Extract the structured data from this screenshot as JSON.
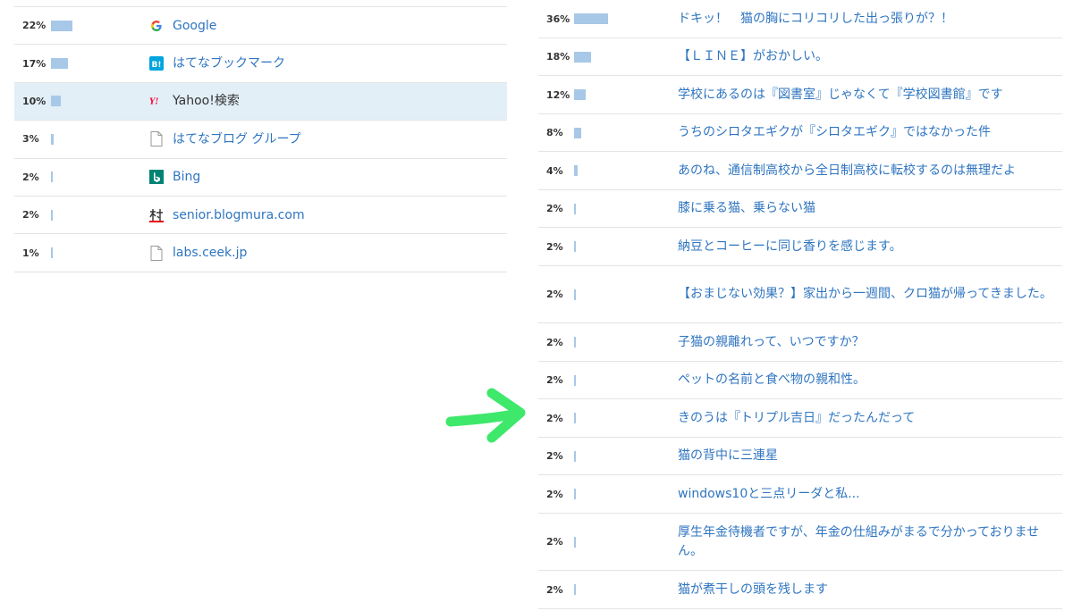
{
  "colors": {
    "bar": "#a7c8e7",
    "link": "#2f75c0",
    "text": "#333333",
    "selected_row": "#e2eff7",
    "divider": "#e4e4e4",
    "arrow": "#3ee86a"
  },
  "referrers": [
    {
      "percent": "22%",
      "value": 22,
      "label": "Google",
      "icon": "google-icon"
    },
    {
      "percent": "17%",
      "value": 17,
      "label": "はてなブックマーク",
      "icon": "hatena-bookmark-icon"
    },
    {
      "percent": "10%",
      "value": 10,
      "label": "Yahoo!検索",
      "icon": "yahoo-icon"
    },
    {
      "percent": "3%",
      "value": 3,
      "label": "はてなブログ グループ",
      "icon": "document-icon"
    },
    {
      "percent": "2%",
      "value": 2,
      "label": "Bing",
      "icon": "bing-icon"
    },
    {
      "percent": "2%",
      "value": 2,
      "label": "senior.blogmura.com",
      "icon": "blogmura-icon"
    },
    {
      "percent": "1%",
      "value": 1,
      "label": "labs.ceek.jp",
      "icon": "document-icon"
    }
  ],
  "articles": [
    {
      "percent": "36%",
      "value": 36,
      "label": "ドキッ！　猫の胸にコリコリした出っ張りが？！"
    },
    {
      "percent": "18%",
      "value": 18,
      "label": "【ＬＩＮＥ】がおかしい。"
    },
    {
      "percent": "12%",
      "value": 12,
      "label": "学校にあるのは『図書室』じゃなくて『学校図書館』です"
    },
    {
      "percent": "8%",
      "value": 8,
      "label": "うちのシロタエギクが『シロタエギク』ではなかった件"
    },
    {
      "percent": "4%",
      "value": 4,
      "label": "あのね、通信制高校から全日制高校に転校するのは無理だよ"
    },
    {
      "percent": "2%",
      "value": 2,
      "label": "膝に乗る猫、乗らない猫"
    },
    {
      "percent": "2%",
      "value": 2,
      "label": "納豆とコーヒーに同じ香りを感じます。"
    },
    {
      "percent": "2%",
      "value": 2,
      "label": "【おまじない効果？】家出から一週間、クロ猫が帰ってきました。"
    },
    {
      "percent": "2%",
      "value": 2,
      "label": "子猫の親離れって、いつですか？"
    },
    {
      "percent": "2%",
      "value": 2,
      "label": "ペットの名前と食べ物の親和性。"
    },
    {
      "percent": "2%",
      "value": 2,
      "label": "きのうは『トリプル吉日』だったんだって"
    },
    {
      "percent": "2%",
      "value": 2,
      "label": "猫の背中に三連星"
    },
    {
      "percent": "2%",
      "value": 2,
      "label": "windows10と三点リーダと私..."
    },
    {
      "percent": "2%",
      "value": 2,
      "label": "厚生年金待機者ですが、年金の仕組みがまるで分かっておりません。"
    },
    {
      "percent": "2%",
      "value": 2,
      "label": "猫が煮干しの頭を残します"
    }
  ]
}
